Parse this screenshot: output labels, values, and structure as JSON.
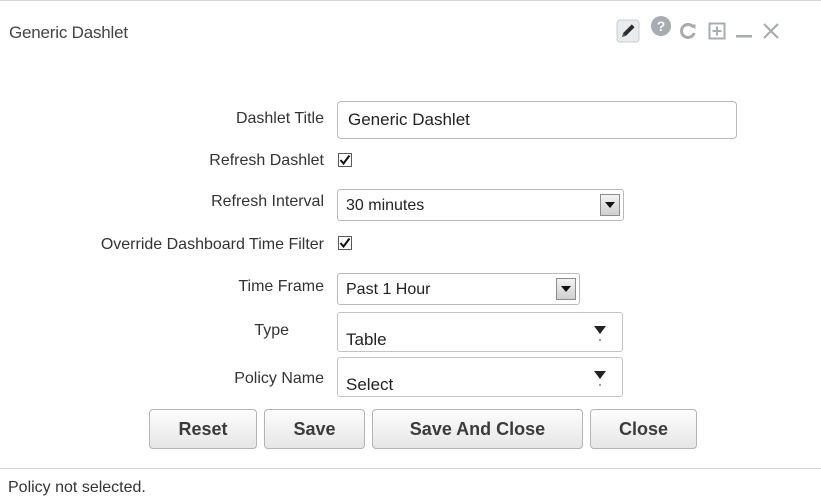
{
  "dashlet": {
    "title": "Generic Dashlet",
    "toolbar": {
      "icons": [
        "pencil-icon",
        "help-icon",
        "refresh-icon",
        "maximize-icon",
        "minimize-icon",
        "close-icon"
      ]
    }
  },
  "form": {
    "dashlet_title": {
      "label": "Dashlet Title",
      "value": "Generic Dashlet"
    },
    "refresh_dashlet": {
      "label": "Refresh Dashlet",
      "checked": true
    },
    "refresh_interval": {
      "label": "Refresh Interval",
      "value": "30 minutes"
    },
    "override_time_filter": {
      "label": "Override Dashboard Time Filter",
      "checked": true
    },
    "time_frame": {
      "label": "Time Frame",
      "value": "Past 1 Hour"
    },
    "type": {
      "label": "Type",
      "value": "Table"
    },
    "policy_name": {
      "label": "Policy Name",
      "value": "Select"
    }
  },
  "buttons": {
    "reset": "Reset",
    "save": "Save",
    "save_and_close": "Save And Close",
    "close": "Close"
  },
  "status": {
    "message": "Policy not selected."
  },
  "colors": {
    "border": "#cfd6dc",
    "text": "#333333",
    "button_text": "#3b3b3b"
  }
}
